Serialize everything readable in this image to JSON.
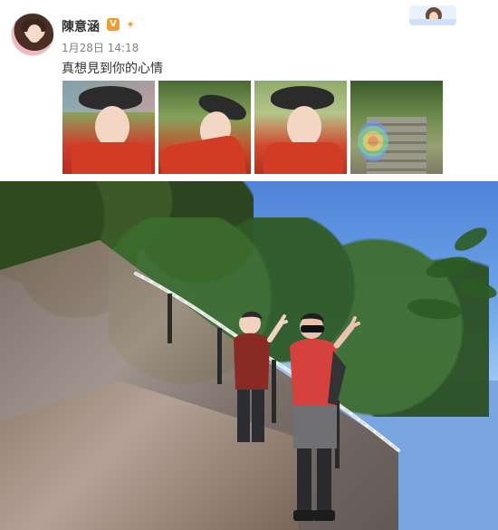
{
  "post": {
    "username": "陳意涵",
    "timestamp": "1月28日 14:18",
    "text": "真想見到你的心情",
    "badges": {
      "verified_letter": "V",
      "crown_icon": "crown-icon"
    }
  },
  "thumbnails": [
    {
      "label": "photo-1"
    },
    {
      "label": "photo-2"
    },
    {
      "label": "photo-3"
    },
    {
      "label": "photo-4"
    }
  ],
  "colors": {
    "username": "#333333",
    "timestamp": "#808080",
    "verified_badge": "#f29b2f"
  }
}
